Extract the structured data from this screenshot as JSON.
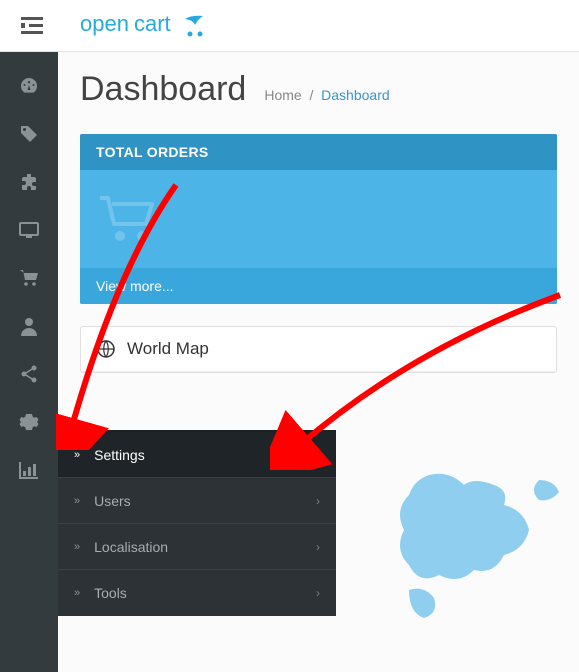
{
  "logo": {
    "text": "opencart"
  },
  "page": {
    "title": "Dashboard",
    "breadcrumb_home": "Home",
    "breadcrumb_current": "Dashboard"
  },
  "sidebar": {
    "icons": [
      "dashboard-icon",
      "tag-icon",
      "extension-icon",
      "design-icon",
      "cart-icon",
      "user-icon",
      "share-icon",
      "gear-icon",
      "stats-icon"
    ]
  },
  "widget_orders": {
    "title": "TOTAL ORDERS",
    "more": "View more..."
  },
  "panel_map": {
    "title": "World Map"
  },
  "flyout": {
    "items": [
      {
        "label": "Settings",
        "has_sub": false,
        "active": true
      },
      {
        "label": "Users",
        "has_sub": true,
        "active": false
      },
      {
        "label": "Localisation",
        "has_sub": true,
        "active": false
      },
      {
        "label": "Tools",
        "has_sub": true,
        "active": false
      }
    ]
  }
}
